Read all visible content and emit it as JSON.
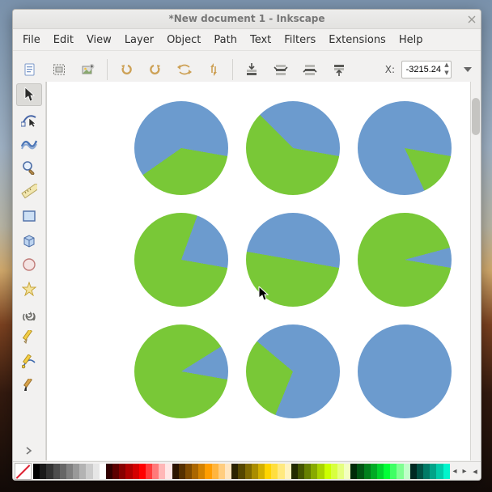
{
  "window": {
    "title": "*New document 1 - Inkscape"
  },
  "menubar": {
    "items": [
      "File",
      "Edit",
      "View",
      "Layer",
      "Object",
      "Path",
      "Text",
      "Filters",
      "Extensions",
      "Help"
    ]
  },
  "toolbar": {
    "coord_label": "X:",
    "coord_value": "-3215.24"
  },
  "colors": {
    "blue": "#6c9bce",
    "green": "#79c837"
  },
  "chart_data": [
    {
      "type": "pie",
      "position": "row1-col1",
      "series": [
        {
          "name": "blue",
          "value": 60
        },
        {
          "name": "green",
          "value": 40
        }
      ],
      "green_start_deg": 100,
      "green_sweep_deg": 135
    },
    {
      "type": "pie",
      "position": "row1-col2",
      "series": [
        {
          "name": "blue",
          "value": 40
        },
        {
          "name": "green",
          "value": 60
        }
      ],
      "green_start_deg": 100,
      "green_sweep_deg": 215
    },
    {
      "type": "pie",
      "position": "row1-col3",
      "series": [
        {
          "name": "blue",
          "value": 86
        },
        {
          "name": "green",
          "value": 14
        }
      ],
      "green_start_deg": 100,
      "green_sweep_deg": 55
    },
    {
      "type": "pie",
      "position": "row2-col1",
      "series": [
        {
          "name": "blue",
          "value": 22
        },
        {
          "name": "green",
          "value": 78
        }
      ],
      "green_start_deg": 100,
      "green_sweep_deg": 280
    },
    {
      "type": "pie",
      "position": "row2-col2",
      "series": [
        {
          "name": "blue",
          "value": 50
        },
        {
          "name": "green",
          "value": 50
        }
      ],
      "green_start_deg": 100,
      "green_sweep_deg": 180
    },
    {
      "type": "pie",
      "position": "row2-col3",
      "series": [
        {
          "name": "blue",
          "value": 8
        },
        {
          "name": "green",
          "value": 92
        }
      ],
      "green_start_deg": 100,
      "green_sweep_deg": 335
    },
    {
      "type": "pie",
      "position": "row3-col1",
      "series": [
        {
          "name": "blue",
          "value": 12
        },
        {
          "name": "green",
          "value": 88
        }
      ],
      "green_start_deg": 100,
      "green_sweep_deg": 318
    },
    {
      "type": "pie",
      "position": "row3-col2",
      "series": [
        {
          "name": "blue",
          "value": 70
        },
        {
          "name": "green",
          "value": 30
        }
      ],
      "green_start_deg": 202,
      "green_sweep_deg": 108
    },
    {
      "type": "pie",
      "position": "row3-col3",
      "series": [
        {
          "name": "blue",
          "value": 100
        },
        {
          "name": "green",
          "value": 0
        }
      ],
      "green_start_deg": 0,
      "green_sweep_deg": 0
    }
  ],
  "pie_layout": {
    "cols_x": [
      108,
      246,
      384
    ],
    "rows_y": [
      24,
      162,
      300
    ],
    "diameter": 116
  },
  "swatches": [
    "#000000",
    "#1a1a1a",
    "#333333",
    "#4d4d4d",
    "#666666",
    "#808080",
    "#999999",
    "#b3b3b3",
    "#cccccc",
    "#e6e6e6",
    "#ffffff",
    "#310000",
    "#5c0000",
    "#870000",
    "#b00000",
    "#d40000",
    "#ff0000",
    "#ff3c3c",
    "#ff7a7a",
    "#ffb7b7",
    "#ffe6e6",
    "#2b1400",
    "#553000",
    "#804b00",
    "#aa6600",
    "#d38200",
    "#ff9d00",
    "#ffb53f",
    "#ffcd7f",
    "#ffe5bf",
    "#2b2300",
    "#554700",
    "#806a00",
    "#aa8d00",
    "#d3b000",
    "#ffd400",
    "#ffde3f",
    "#ffe97f",
    "#fff3bf",
    "#222b00",
    "#445500",
    "#668000",
    "#88aa00",
    "#aad400",
    "#ccff00",
    "#d8ff3f",
    "#e5ff7f",
    "#f2ffbf",
    "#002b08",
    "#005512",
    "#00801b",
    "#00aa24",
    "#00d42d",
    "#00ff36",
    "#3fff64",
    "#7fff92",
    "#bfffc8",
    "#002922",
    "#005244",
    "#007a66",
    "#00a388",
    "#00ccaa",
    "#00f5cc"
  ]
}
